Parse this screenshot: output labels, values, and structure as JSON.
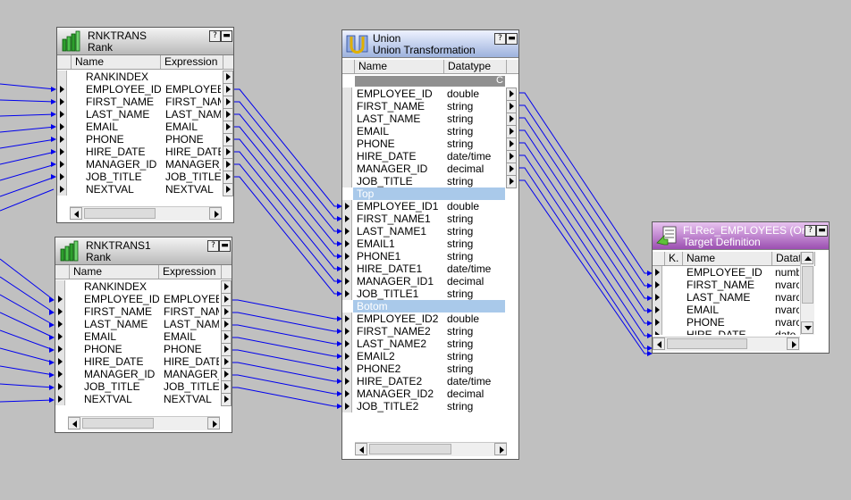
{
  "colors": {
    "link_line": "#0000ee",
    "canvas": "#c0c0c0",
    "group_header": "#a9c9ea"
  },
  "rnktrans": {
    "name": "RNKTRANS",
    "type": "Rank",
    "help_btn": "?",
    "min_btn": "▬",
    "columns": [
      "Name",
      "Expression"
    ],
    "rows": [
      {
        "name": "RANKINDEX",
        "expr": ""
      },
      {
        "name": "EMPLOYEE_ID",
        "expr": "EMPLOYEE_"
      },
      {
        "name": "FIRST_NAME",
        "expr": "FIRST_NAM"
      },
      {
        "name": "LAST_NAME",
        "expr": "LAST_NAME"
      },
      {
        "name": "EMAIL",
        "expr": "EMAIL"
      },
      {
        "name": "PHONE",
        "expr": "PHONE"
      },
      {
        "name": "HIRE_DATE",
        "expr": "HIRE_DATE"
      },
      {
        "name": "MANAGER_ID",
        "expr": "MANAGER_"
      },
      {
        "name": "JOB_TITLE",
        "expr": "JOB_TITLE"
      },
      {
        "name": "NEXTVAL",
        "expr": "NEXTVAL"
      }
    ]
  },
  "rnktrans1": {
    "name": "RNKTRANS1",
    "type": "Rank",
    "help_btn": "?",
    "min_btn": "▬",
    "columns": [
      "Name",
      "Expression"
    ],
    "rows": [
      {
        "name": "RANKINDEX",
        "expr": ""
      },
      {
        "name": "EMPLOYEE_ID",
        "expr": "EMPLOYEE_"
      },
      {
        "name": "FIRST_NAME",
        "expr": "FIRST_NAM"
      },
      {
        "name": "LAST_NAME",
        "expr": "LAST_NAME"
      },
      {
        "name": "EMAIL",
        "expr": "EMAIL"
      },
      {
        "name": "PHONE",
        "expr": "PHONE"
      },
      {
        "name": "HIRE_DATE",
        "expr": "HIRE_DATE"
      },
      {
        "name": "MANAGER_ID",
        "expr": "MANAGER_I"
      },
      {
        "name": "JOB_TITLE",
        "expr": "JOB_TITLE"
      },
      {
        "name": "NEXTVAL",
        "expr": "NEXTVAL"
      }
    ]
  },
  "union": {
    "name": "Union",
    "type": "Union Transformation",
    "help_btn": "?",
    "min_btn": "▬",
    "columns": [
      "Name",
      "Datatype"
    ],
    "header_row_fragment": "C",
    "output_rows": [
      {
        "name": "EMPLOYEE_ID",
        "dtype": "double"
      },
      {
        "name": "FIRST_NAME",
        "dtype": "string"
      },
      {
        "name": "LAST_NAME",
        "dtype": "string"
      },
      {
        "name": "EMAIL",
        "dtype": "string"
      },
      {
        "name": "PHONE",
        "dtype": "string"
      },
      {
        "name": "HIRE_DATE",
        "dtype": "date/time"
      },
      {
        "name": "MANAGER_ID",
        "dtype": "decimal"
      },
      {
        "name": "JOB_TITLE",
        "dtype": "string"
      }
    ],
    "groups": [
      {
        "label": "Top",
        "rows": [
          {
            "name": "EMPLOYEE_ID1",
            "dtype": "double"
          },
          {
            "name": "FIRST_NAME1",
            "dtype": "string"
          },
          {
            "name": "LAST_NAME1",
            "dtype": "string"
          },
          {
            "name": "EMAIL1",
            "dtype": "string"
          },
          {
            "name": "PHONE1",
            "dtype": "string"
          },
          {
            "name": "HIRE_DATE1",
            "dtype": "date/time"
          },
          {
            "name": "MANAGER_ID1",
            "dtype": "decimal"
          },
          {
            "name": "JOB_TITLE1",
            "dtype": "string"
          }
        ]
      },
      {
        "label": "Botom",
        "rows": [
          {
            "name": "EMPLOYEE_ID2",
            "dtype": "double"
          },
          {
            "name": "FIRST_NAME2",
            "dtype": "string"
          },
          {
            "name": "LAST_NAME2",
            "dtype": "string"
          },
          {
            "name": "EMAIL2",
            "dtype": "string"
          },
          {
            "name": "PHONE2",
            "dtype": "string"
          },
          {
            "name": "HIRE_DATE2",
            "dtype": "date/time"
          },
          {
            "name": "MANAGER_ID2",
            "dtype": "decimal"
          },
          {
            "name": "JOB_TITLE2",
            "dtype": "string"
          }
        ]
      }
    ]
  },
  "target": {
    "name": "FLRec_EMPLOYEES (Or...",
    "type": "Target Definition",
    "help_btn": "?",
    "min_btn": "▬",
    "columns": [
      "K.",
      "Name",
      "Dataty"
    ],
    "rows": [
      {
        "name": "EMPLOYEE_ID",
        "dtype": "numbe"
      },
      {
        "name": "FIRST_NAME",
        "dtype": "nvarc"
      },
      {
        "name": "LAST_NAME",
        "dtype": "nvarc"
      },
      {
        "name": "EMAIL",
        "dtype": "nvarc"
      },
      {
        "name": "PHONE",
        "dtype": "nvarc"
      },
      {
        "name": "HIRE_DATE",
        "dtype": "date"
      }
    ]
  }
}
